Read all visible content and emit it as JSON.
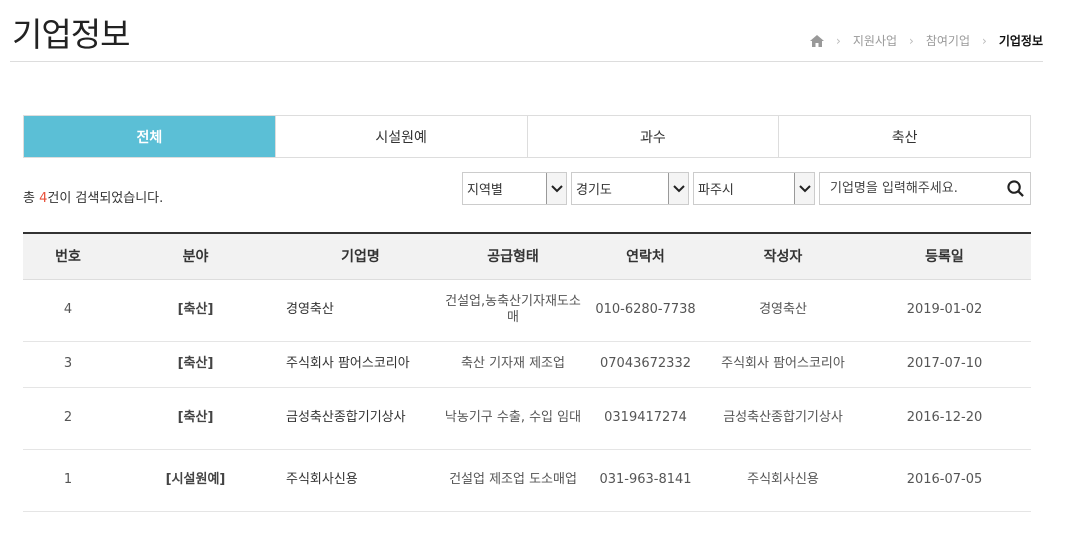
{
  "page": {
    "title": "기업정보"
  },
  "breadcrumb": {
    "items": [
      "지원사업",
      "참여기업"
    ],
    "current": "기업정보"
  },
  "tabs": [
    {
      "label": "전체",
      "active": true
    },
    {
      "label": "시설원예",
      "active": false
    },
    {
      "label": "과수",
      "active": false
    },
    {
      "label": "축산",
      "active": false
    }
  ],
  "result": {
    "prefix": "총 ",
    "count": "4",
    "suffix": "건이 검색되었습니다."
  },
  "filters": {
    "region_type": "지역별",
    "province": "경기도",
    "city": "파주시",
    "search_placeholder": "기업명을 입력해주세요."
  },
  "table": {
    "headers": [
      "번호",
      "분야",
      "기업명",
      "공급형태",
      "연락처",
      "작성자",
      "등록일"
    ],
    "rows": [
      {
        "no": "4",
        "category": "[축산]",
        "company": "경영축산",
        "supply": "건설업,농축산기자재도소매",
        "contact": "010-6280-7738",
        "author": "경영축산",
        "date": "2019-01-02"
      },
      {
        "no": "3",
        "category": "[축산]",
        "company": "주식회사 팜어스코리아",
        "supply": "축산 기자재 제조업",
        "contact": "07043672332",
        "author": "주식회사 팜어스코리아",
        "date": "2017-07-10"
      },
      {
        "no": "2",
        "category": "[축산]",
        "company": "금성축산종합기기상사",
        "supply": "낙농기구 수출, 수입 임대",
        "contact": "0319417274",
        "author": "금성축산종합기기상사",
        "date": "2016-12-20"
      },
      {
        "no": "1",
        "category": "[시설원예]",
        "company": "주식회사신용",
        "supply": "건설업 제조업 도소매업",
        "contact": "031-963-8141",
        "author": "주식회사신용",
        "date": "2016-07-05"
      }
    ]
  },
  "colors": {
    "accent": "#5bbfd6",
    "count": "#e8503a"
  }
}
